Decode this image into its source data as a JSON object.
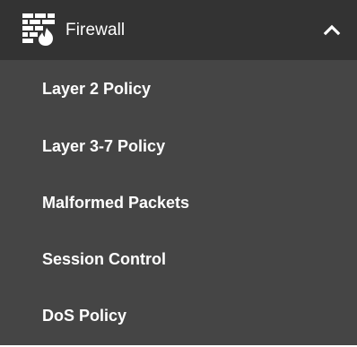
{
  "section": {
    "title": "Firewall",
    "icon": "firewall-icon",
    "expanded": true,
    "toggle_icon": "chevron-up-icon"
  },
  "menu": {
    "items": [
      {
        "label": "Layer 2 Policy"
      },
      {
        "label": "Layer 3-7 Policy"
      },
      {
        "label": "Malformed Packets"
      },
      {
        "label": "Session Control"
      },
      {
        "label": "DoS Policy"
      }
    ]
  },
  "colors": {
    "header_bg": "#333333",
    "menu_bg": "#454545",
    "text": "#ffffff"
  }
}
